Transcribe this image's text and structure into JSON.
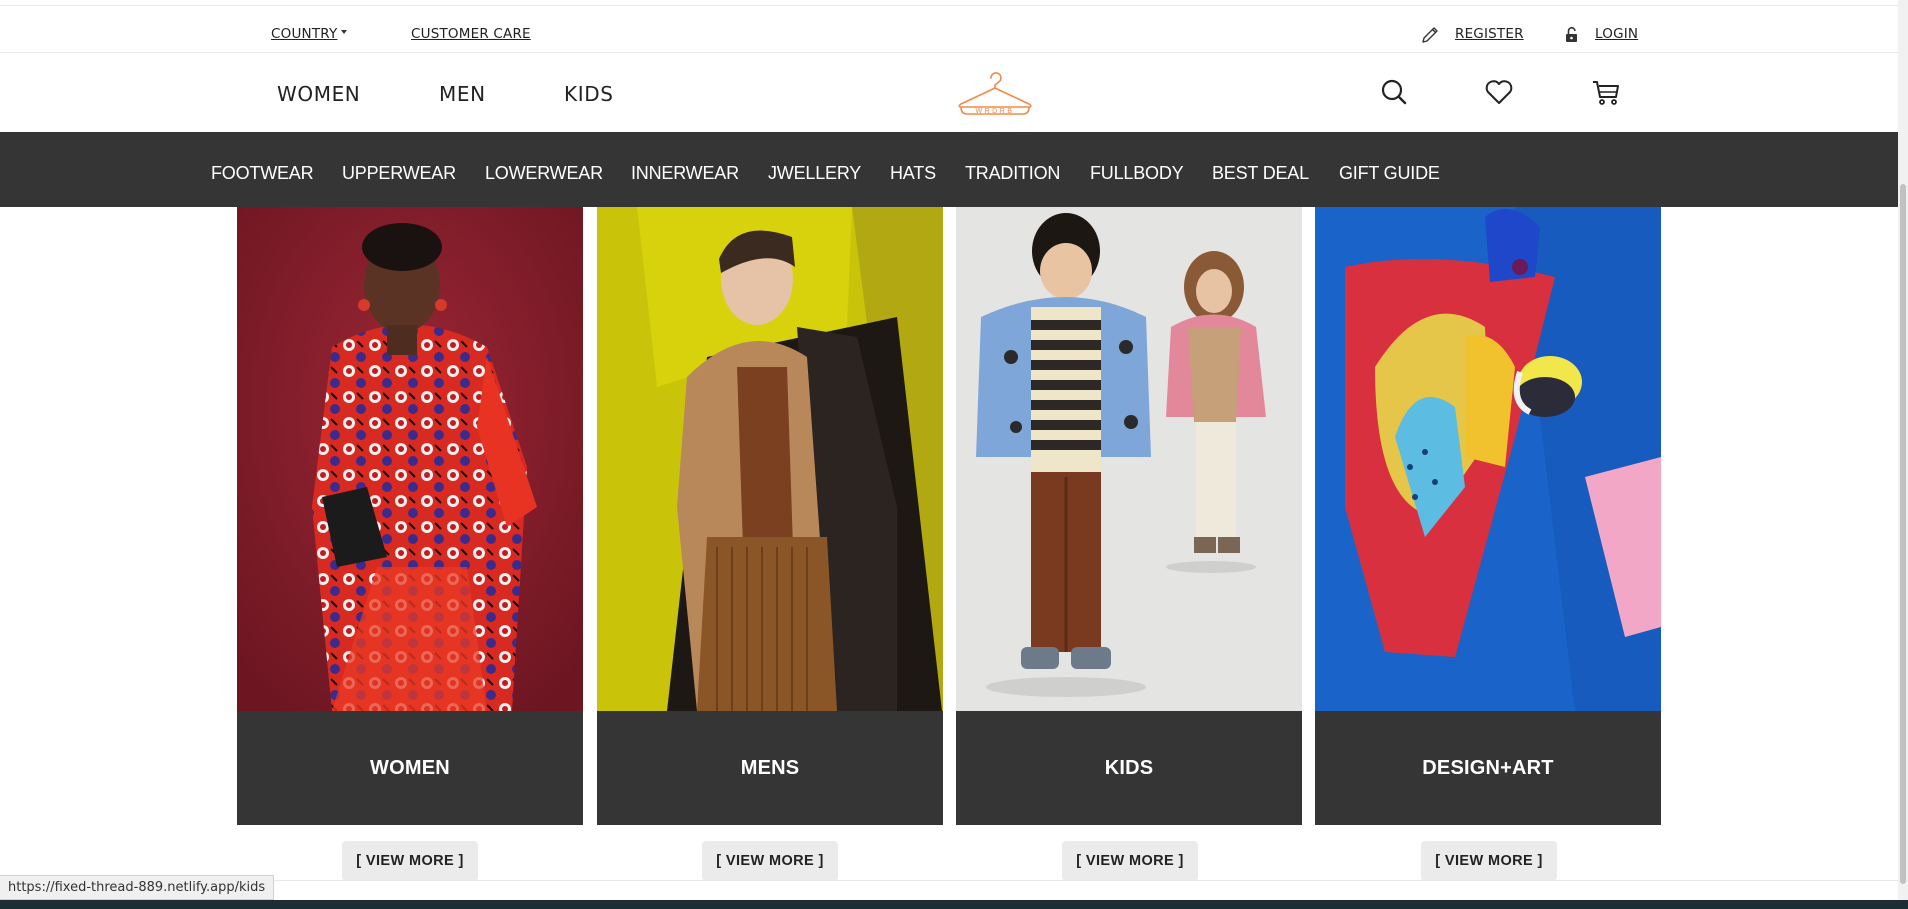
{
  "utility": {
    "country_label": "COUNTRY",
    "customer_care_label": "CUSTOMER CARE",
    "register_label": "REGISTER",
    "login_label": "LOGIN"
  },
  "nav": {
    "women_label": "WOMEN",
    "men_label": "MEN",
    "kids_label": "KIDS",
    "logo_text": "WRDRB",
    "logo_color": "#f08a4b"
  },
  "categories": [
    "FOOTWEAR",
    "UPPERWEAR",
    "LOWERWEAR",
    "INNERWEAR",
    "JWELLERY",
    "HATS",
    "TRADITION",
    "FULLBODY",
    "BEST DEAL",
    "GIFT GUIDE"
  ],
  "cards": [
    {
      "label": "WOMEN",
      "button": "[ VIEW MORE ]"
    },
    {
      "label": "MENS",
      "button": "[ VIEW MORE ]"
    },
    {
      "label": "KIDS",
      "button": "[ VIEW MORE ]"
    },
    {
      "label": "DESIGN+ART",
      "button": "[ VIEW MORE ]"
    }
  ],
  "status_bar": {
    "url": "https://fixed-thread-889.netlify.app/kids"
  },
  "colors": {
    "dark_bar": "#353535",
    "accent": "#f08a4b",
    "button_bg": "#ebebeb"
  },
  "icons": [
    "pencil-icon",
    "unlock-icon",
    "search-icon",
    "heart-icon",
    "cart-icon",
    "hanger-logo-icon"
  ]
}
